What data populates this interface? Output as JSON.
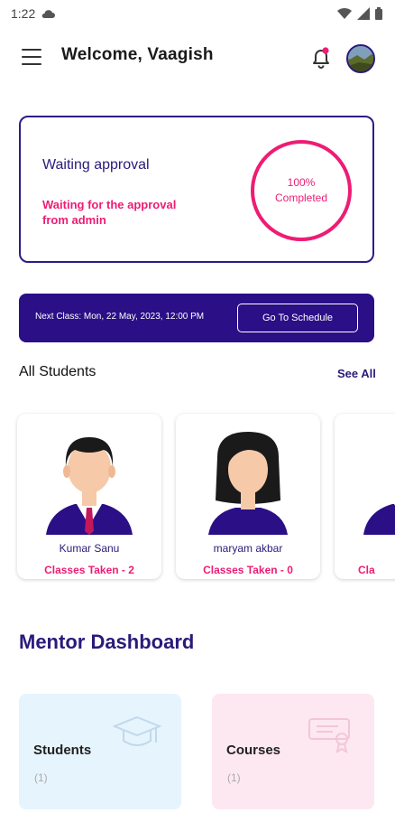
{
  "status_bar": {
    "time": "1:22",
    "icons": [
      "cloud-icon",
      "wifi-icon",
      "signal-icon",
      "battery-icon"
    ]
  },
  "app_bar": {
    "title": "Welcome, Vaagish",
    "icons": [
      "menu-icon",
      "bell-icon",
      "avatar"
    ],
    "notification_dot_color": "#ee1c74"
  },
  "approval_card": {
    "title": "Waiting approval",
    "subtitle": "Waiting for the approval from admin",
    "progress_value": "100%",
    "progress_label": "Completed",
    "progress_fraction": 1.0
  },
  "next_class": {
    "text": "Next Class: Mon, 22 May, 2023, 12:00 PM",
    "button_label": "Go To Schedule"
  },
  "students_section": {
    "title": "All Students",
    "see_all_label": "See All",
    "students": [
      {
        "name": "Kumar Sanu",
        "classes": "Classes Taken - 2",
        "avatar": "male-avatar-icon"
      },
      {
        "name": "maryam akbar",
        "classes": "Classes Taken - 0",
        "avatar": "female-avatar-icon"
      },
      {
        "name": "",
        "classes": "Cla",
        "avatar": "male-avatar-icon"
      }
    ]
  },
  "dashboard": {
    "title": "Mentor Dashboard",
    "cards": [
      {
        "label": "Students",
        "count": "(1)",
        "icon": "graduation-cap-icon",
        "color": "#e6f4fd"
      },
      {
        "label": "Courses",
        "count": "(1)",
        "icon": "certificate-icon",
        "color": "#fde8f1"
      }
    ]
  },
  "colors": {
    "primary": "#2a0f86",
    "accent": "#ee1c74"
  }
}
